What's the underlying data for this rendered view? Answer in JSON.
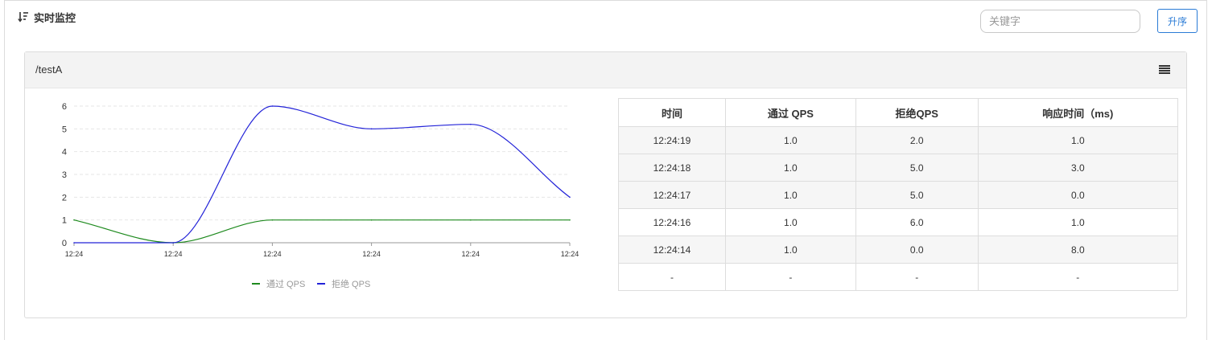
{
  "header": {
    "title": "实时监控",
    "search_placeholder": "关键字",
    "sort_button_label": "升序"
  },
  "panel": {
    "resource": "/testA"
  },
  "chart_data": {
    "type": "line",
    "x": [
      "12:24",
      "12:24",
      "12:24",
      "12:24",
      "12:24",
      "12:24"
    ],
    "ylim": [
      0,
      6
    ],
    "yticks": [
      0,
      1,
      2,
      3,
      4,
      5,
      6
    ],
    "grid": true,
    "legend": "bottom",
    "series": [
      {
        "name": "通过 QPS",
        "values": [
          1,
          0,
          1,
          1,
          1,
          1
        ],
        "color": "#1e8a1e"
      },
      {
        "name": "拒绝 QPS",
        "values": [
          0,
          0,
          6,
          5,
          5.2,
          2
        ],
        "color": "#2323d8"
      }
    ]
  },
  "table": {
    "headers": [
      "时间",
      "通过 QPS",
      "拒绝QPS",
      "响应时间（ms)"
    ],
    "rows": [
      [
        "12:24:19",
        "1.0",
        "2.0",
        "1.0"
      ],
      [
        "12:24:18",
        "1.0",
        "5.0",
        "3.0"
      ],
      [
        "12:24:17",
        "1.0",
        "5.0",
        "0.0"
      ],
      [
        "12:24:16",
        "1.0",
        "6.0",
        "1.0"
      ],
      [
        "12:24:14",
        "1.0",
        "0.0",
        "8.0"
      ],
      [
        "-",
        "-",
        "-",
        "-"
      ]
    ]
  }
}
